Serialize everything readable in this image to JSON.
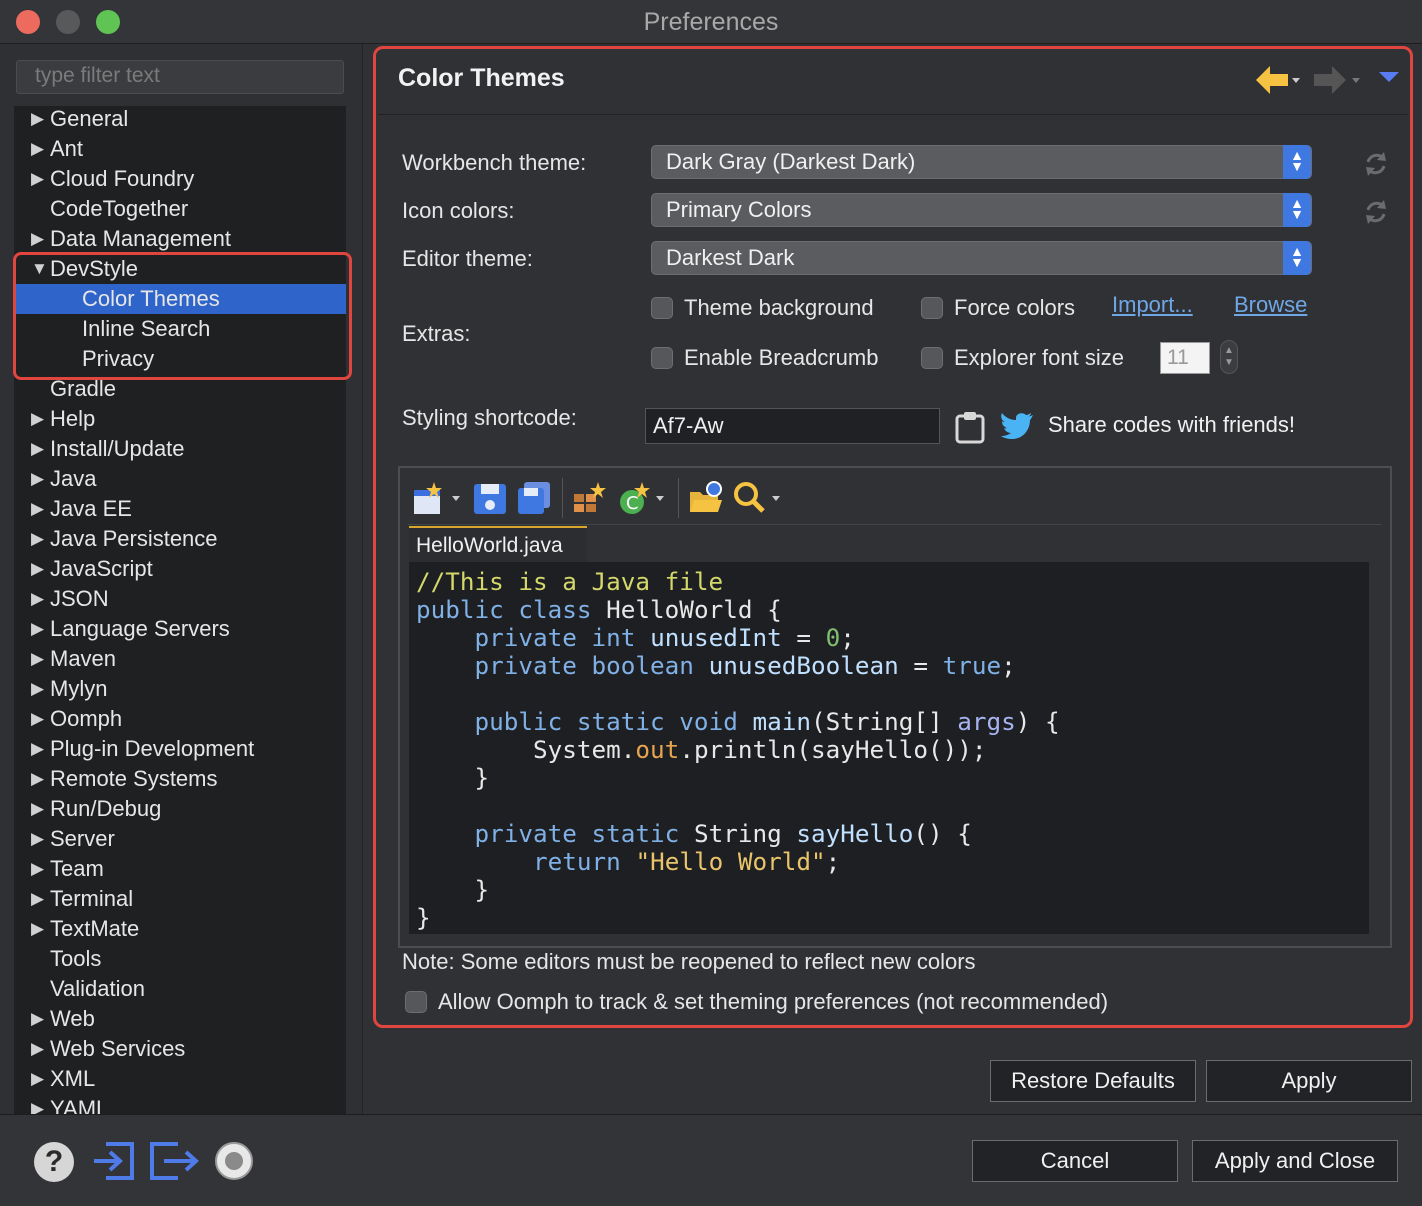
{
  "window": {
    "title": "Preferences"
  },
  "filter": {
    "placeholder": "type filter text"
  },
  "tree": {
    "items": [
      {
        "label": "General",
        "expandable": true
      },
      {
        "label": "Ant",
        "expandable": true
      },
      {
        "label": "Cloud Foundry",
        "expandable": true
      },
      {
        "label": "CodeTogether",
        "expandable": false
      },
      {
        "label": "Data Management",
        "expandable": true
      },
      {
        "label": "DevStyle",
        "expandable": true,
        "expanded": true
      },
      {
        "label": "Color Themes",
        "child": true,
        "selected": true
      },
      {
        "label": "Inline Search",
        "child": true
      },
      {
        "label": "Privacy",
        "child": true
      },
      {
        "label": "Gradle",
        "expandable": false
      },
      {
        "label": "Help",
        "expandable": true
      },
      {
        "label": "Install/Update",
        "expandable": true
      },
      {
        "label": "Java",
        "expandable": true
      },
      {
        "label": "Java EE",
        "expandable": true
      },
      {
        "label": "Java Persistence",
        "expandable": true
      },
      {
        "label": "JavaScript",
        "expandable": true
      },
      {
        "label": "JSON",
        "expandable": true
      },
      {
        "label": "Language Servers",
        "expandable": true
      },
      {
        "label": "Maven",
        "expandable": true
      },
      {
        "label": "Mylyn",
        "expandable": true
      },
      {
        "label": "Oomph",
        "expandable": true
      },
      {
        "label": "Plug-in Development",
        "expandable": true
      },
      {
        "label": "Remote Systems",
        "expandable": true
      },
      {
        "label": "Run/Debug",
        "expandable": true
      },
      {
        "label": "Server",
        "expandable": true
      },
      {
        "label": "Team",
        "expandable": true
      },
      {
        "label": "Terminal",
        "expandable": true
      },
      {
        "label": "TextMate",
        "expandable": true
      },
      {
        "label": "Tools",
        "expandable": false
      },
      {
        "label": "Validation",
        "expandable": false
      },
      {
        "label": "Web",
        "expandable": true
      },
      {
        "label": "Web Services",
        "expandable": true
      },
      {
        "label": "XML",
        "expandable": true
      },
      {
        "label": "YAML",
        "expandable": true
      }
    ]
  },
  "page": {
    "title": "Color Themes",
    "workbench_label": "Workbench theme:",
    "workbench_value": "Dark Gray (Darkest Dark)",
    "icon_label": "Icon colors:",
    "icon_value": "Primary Colors",
    "editor_label": "Editor theme:",
    "editor_value": "Darkest Dark",
    "extras_label": "Extras:",
    "extras": {
      "theme_background": "Theme background",
      "force_colors": "Force colors",
      "import_link": "Import...",
      "browse_link": "Browse",
      "enable_breadcrumb": "Enable Breadcrumb",
      "explorer_font_size": "Explorer font size",
      "font_size_value": "11"
    },
    "shortcode_label": "Styling shortcode:",
    "shortcode_value": "Af7-Aw",
    "share_text": "Share codes with friends!",
    "preview_tab": "HelloWorld.java",
    "code_lines": [
      [
        [
          "cm",
          "//This is a Java file"
        ]
      ],
      [
        [
          "kw",
          "public class "
        ],
        [
          "",
          "HelloWorld {"
        ]
      ],
      [
        [
          "",
          "    "
        ],
        [
          "kw",
          "private int "
        ],
        [
          "mth",
          "unusedInt"
        ],
        [
          "",
          " = "
        ],
        [
          "num",
          "0"
        ],
        [
          "",
          ";"
        ]
      ],
      [
        [
          "",
          "    "
        ],
        [
          "kw",
          "private boolean "
        ],
        [
          "mth",
          "unusedBoolean"
        ],
        [
          "",
          " = "
        ],
        [
          "kw",
          "true"
        ],
        [
          "",
          ";"
        ]
      ],
      [
        [
          "",
          ""
        ]
      ],
      [
        [
          "",
          "    "
        ],
        [
          "kw",
          "public static void "
        ],
        [
          "mth",
          "main"
        ],
        [
          "",
          "(String[] "
        ],
        [
          "par",
          "args"
        ],
        [
          "",
          ") {"
        ]
      ],
      [
        [
          "",
          "        System."
        ],
        [
          "fld",
          "out"
        ],
        [
          "",
          ".println(sayHello());"
        ]
      ],
      [
        [
          "",
          "    }"
        ]
      ],
      [
        [
          "",
          ""
        ]
      ],
      [
        [
          "",
          "    "
        ],
        [
          "kw",
          "private static "
        ],
        [
          "",
          "String "
        ],
        [
          "mth",
          "sayHello"
        ],
        [
          "",
          "() {"
        ]
      ],
      [
        [
          "",
          "        "
        ],
        [
          "kw",
          "return "
        ],
        [
          "str",
          "\"Hello World\""
        ],
        [
          "",
          ";"
        ]
      ],
      [
        [
          "",
          "    }"
        ]
      ],
      [
        [
          "",
          "}"
        ]
      ]
    ],
    "note": "Note: Some editors must be reopened to reflect new colors",
    "oomph_label": "Allow Oomph to track & set theming preferences (not recommended)"
  },
  "buttons": {
    "restore_defaults": "Restore Defaults",
    "apply": "Apply",
    "cancel": "Cancel",
    "apply_and_close": "Apply and Close"
  },
  "colors": {
    "accent": "#2f65ca",
    "highlight_border": "#e0453f",
    "select_spinner": "#3f78e0",
    "link": "#6fa7e6"
  }
}
